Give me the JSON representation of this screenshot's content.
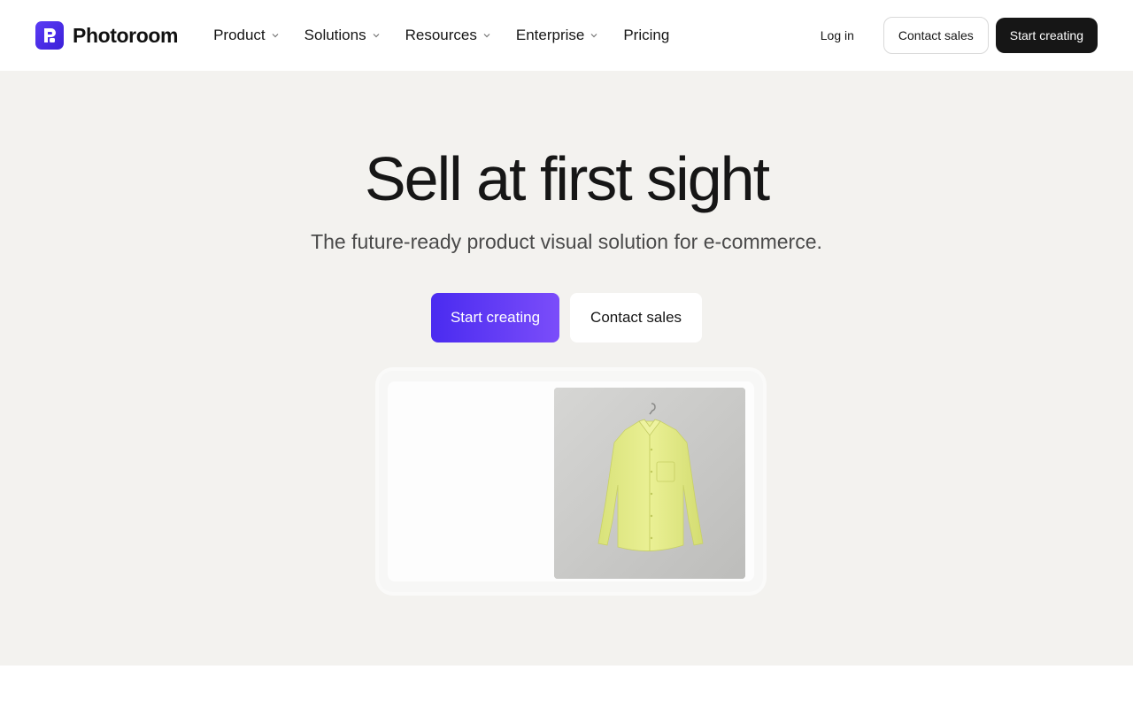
{
  "brand": {
    "name": "Photoroom",
    "color": "#4a2bf0"
  },
  "nav": {
    "items": [
      {
        "label": "Product",
        "has_dropdown": true
      },
      {
        "label": "Solutions",
        "has_dropdown": true
      },
      {
        "label": "Resources",
        "has_dropdown": true
      },
      {
        "label": "Enterprise",
        "has_dropdown": true
      },
      {
        "label": "Pricing",
        "has_dropdown": false
      }
    ]
  },
  "header": {
    "login_label": "Log in",
    "contact_label": "Contact sales",
    "start_label": "Start creating"
  },
  "hero": {
    "title": "Sell at first sight",
    "subtitle": "The future-ready product visual solution for e-commerce.",
    "primary_cta": "Start creating",
    "secondary_cta": "Contact sales"
  },
  "preview": {
    "image": "yellow-shirt-on-hanger",
    "shirt_color": "#e4ec8a",
    "background_color": "#c9c9c7"
  },
  "colors": {
    "hero_bg": "#f3f2ef",
    "dark_button": "#161616",
    "gradient_start": "#4a2bf0",
    "gradient_end": "#7b4dfa"
  }
}
